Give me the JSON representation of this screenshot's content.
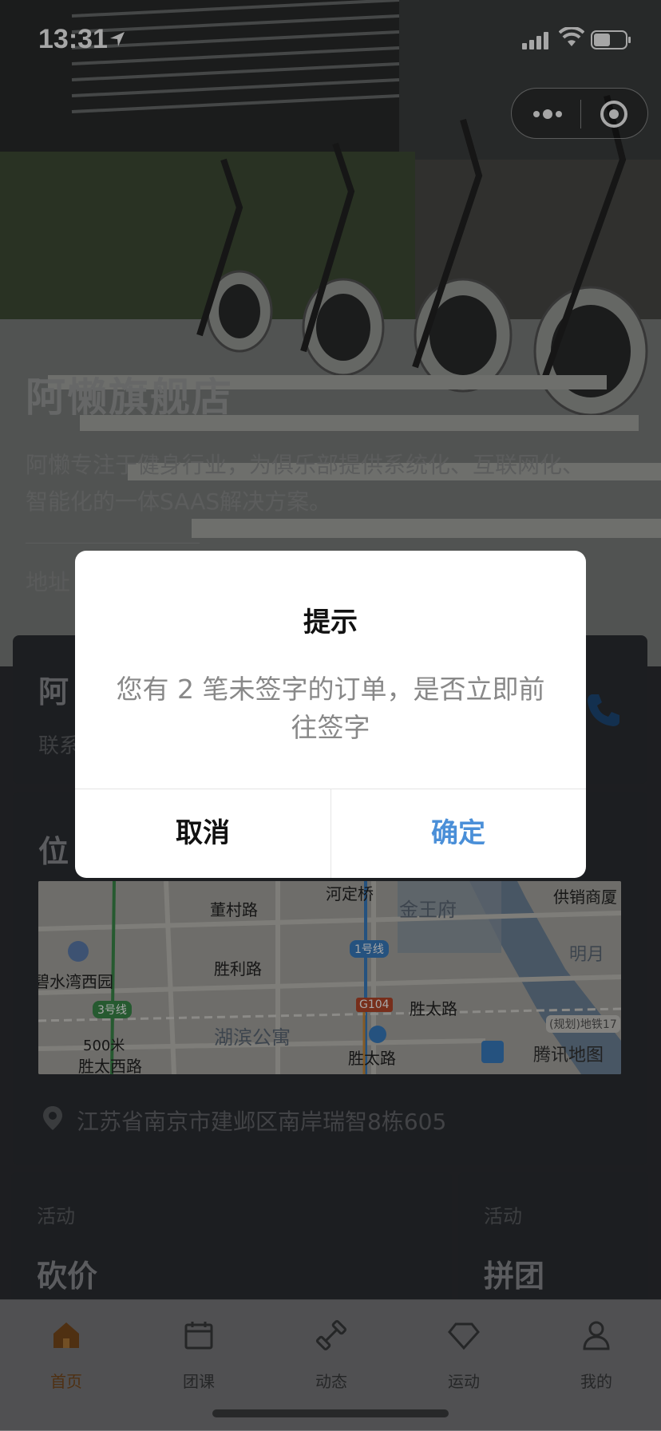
{
  "status": {
    "time": "13:31"
  },
  "hero": {
    "title": "阿懒旗舰店",
    "description": "阿懒专注于健身行业，为俱乐部提供系统化、互联网化、智能化的一体SAAS解决方案。",
    "address_label": "地址"
  },
  "store_card": {
    "name": "阿",
    "contact": "联系"
  },
  "location_card": {
    "title": "位",
    "address": "江苏省南京市建邺区南岸瑞智8栋605",
    "map": {
      "labels": [
        "河定桥",
        "董村路",
        "金王府",
        "供销商厦",
        "明月",
        "碧水湾西园",
        "胜利路",
        "1号线",
        "3号线",
        "G104",
        "胜太路",
        "湖滨公寓",
        "胜太路",
        "(规划)地铁17",
        "胜太西路",
        "500米"
      ],
      "brand": "腾讯地图"
    }
  },
  "activities": [
    {
      "tag": "活动",
      "name": "砍价"
    },
    {
      "tag": "活动",
      "name": "拼团"
    }
  ],
  "tabbar": {
    "items": [
      {
        "label": "首页",
        "icon": "home-icon"
      },
      {
        "label": "团课",
        "icon": "calendar-icon"
      },
      {
        "label": "动态",
        "icon": "dumbbell-icon"
      },
      {
        "label": "运动",
        "icon": "diamond-icon"
      },
      {
        "label": "我的",
        "icon": "user-icon"
      }
    ],
    "active_color": "#e07b1e"
  },
  "dialog": {
    "title": "提示",
    "message": "您有 2 笔未签字的订单，是否立即前往签字",
    "cancel_label": "取消",
    "confirm_label": "确定",
    "confirm_color": "#4a8fd8"
  }
}
